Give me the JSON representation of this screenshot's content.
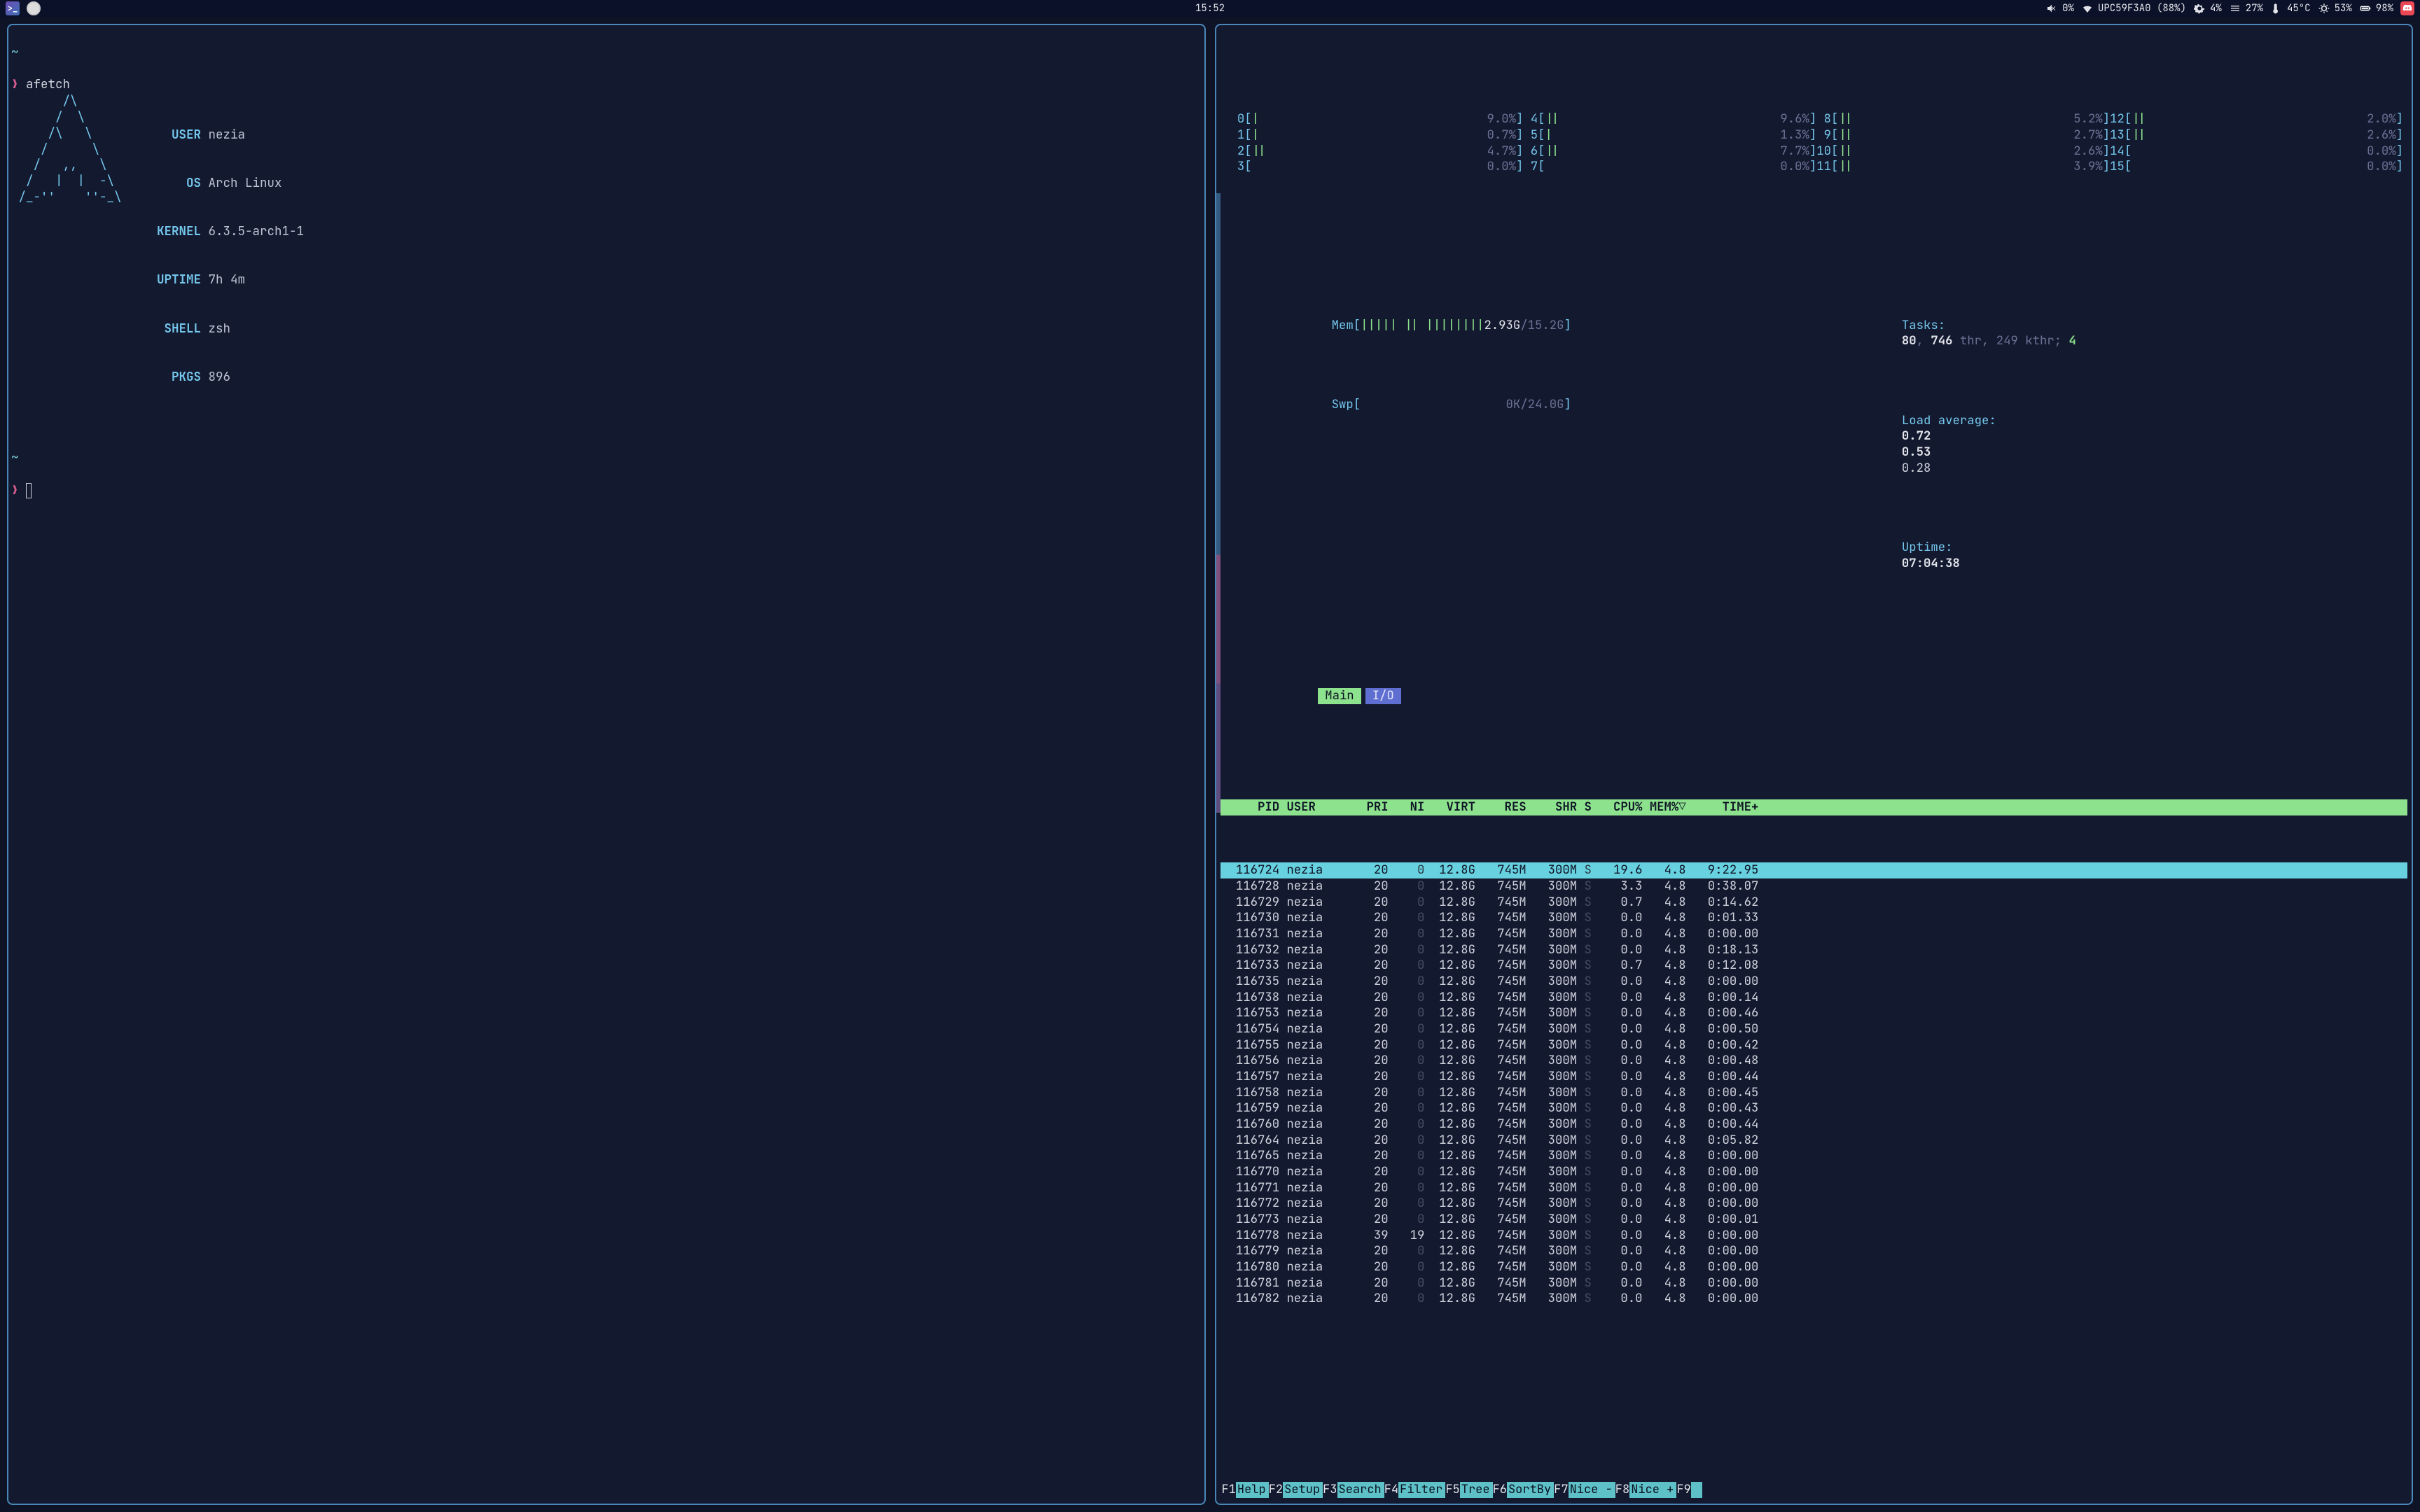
{
  "topbar": {
    "clock": "15:52",
    "vol_pct": "0%",
    "wifi": "UPC59F3A0 (88%)",
    "gear_pct": "4%",
    "menu_pct": "27%",
    "temp": "45°C",
    "bright_pct": "53%",
    "battery_pct": "98%"
  },
  "afetch": {
    "cmd": "afetch",
    "ascii": [
      "       /\\",
      "      /  \\",
      "     /\\   \\",
      "    /      \\",
      "   /   ,,   \\",
      "  /   |  |  -\\",
      " /_-''    ''-_\\"
    ],
    "labels": {
      "user": "USER",
      "os": "OS",
      "kernel": "KERNEL",
      "uptime": "UPTIME",
      "shell": "SHELL",
      "pkgs": "PKGS"
    },
    "values": {
      "user": "nezia",
      "os": "Arch Linux",
      "kernel": "6.3.5-arch1-1",
      "uptime": "7h 4m",
      "shell": "zsh",
      "pkgs": "896"
    }
  },
  "htop": {
    "cpus": [
      {
        "id": "0",
        "bar": "|",
        "pct": "9.0%"
      },
      {
        "id": "4",
        "bar": "||",
        "pct": "9.6%"
      },
      {
        "id": "8",
        "bar": "||",
        "pct": "5.2%"
      },
      {
        "id": "12",
        "bar": "||",
        "pct": "2.0%"
      },
      {
        "id": "1",
        "bar": "|",
        "pct": "0.7%"
      },
      {
        "id": "5",
        "bar": "|",
        "pct": "1.3%"
      },
      {
        "id": "9",
        "bar": "||",
        "pct": "2.7%"
      },
      {
        "id": "13",
        "bar": "||",
        "pct": "2.6%"
      },
      {
        "id": "2",
        "bar": "||",
        "pct": "4.7%"
      },
      {
        "id": "6",
        "bar": "||",
        "pct": "7.7%"
      },
      {
        "id": "10",
        "bar": "||",
        "pct": "2.6%"
      },
      {
        "id": "14",
        "bar": "",
        "pct": "0.0%"
      },
      {
        "id": "3",
        "bar": "",
        "pct": "0.0%"
      },
      {
        "id": "7",
        "bar": "",
        "pct": "0.0%"
      },
      {
        "id": "11",
        "bar": "||",
        "pct": "3.9%"
      },
      {
        "id": "15",
        "bar": "",
        "pct": "0.0%"
      }
    ],
    "mem": {
      "label": "Mem",
      "bar": "||||| || ||||||||",
      "used": "2.93G",
      "total": "15.2G"
    },
    "swp": {
      "label": "Swp",
      "used": "0K",
      "total": "24.0G"
    },
    "tasks": {
      "label": "Tasks:",
      "procs": "80",
      "thr": "746",
      "thr_lbl": " thr",
      "kthr": "249 kthr",
      "running": "4"
    },
    "load": {
      "label": "Load average:",
      "v1": "0.72",
      "v2": "0.53",
      "v3": "0.28"
    },
    "uptime": {
      "label": "Uptime:",
      "value": "07:04:38"
    },
    "tabs": {
      "main": "Main",
      "io": "I/O"
    },
    "header": {
      "pid": "PID",
      "user": "USER",
      "pri": "PRI",
      "ni": "NI",
      "virt": "VIRT",
      "res": "RES",
      "shr": "SHR",
      "s": "S",
      "cpu": "CPU%",
      "mem": "MEM%▽",
      "time": "TIME+"
    },
    "procs": [
      {
        "pid": "116724",
        "user": "nezia",
        "pri": "20",
        "ni": "0",
        "virt": "12.8G",
        "res": "745M",
        "shr": "300M",
        "s": "S",
        "cpu": "19.6",
        "mem": "4.8",
        "time": "9:22.95",
        "sel": true
      },
      {
        "pid": "116728",
        "user": "nezia",
        "pri": "20",
        "ni": "0",
        "virt": "12.8G",
        "res": "745M",
        "shr": "300M",
        "s": "S",
        "cpu": "3.3",
        "mem": "4.8",
        "time": "0:38.07"
      },
      {
        "pid": "116729",
        "user": "nezia",
        "pri": "20",
        "ni": "0",
        "virt": "12.8G",
        "res": "745M",
        "shr": "300M",
        "s": "S",
        "cpu": "0.7",
        "mem": "4.8",
        "time": "0:14.62"
      },
      {
        "pid": "116730",
        "user": "nezia",
        "pri": "20",
        "ni": "0",
        "virt": "12.8G",
        "res": "745M",
        "shr": "300M",
        "s": "S",
        "cpu": "0.0",
        "mem": "4.8",
        "time": "0:01.33"
      },
      {
        "pid": "116731",
        "user": "nezia",
        "pri": "20",
        "ni": "0",
        "virt": "12.8G",
        "res": "745M",
        "shr": "300M",
        "s": "S",
        "cpu": "0.0",
        "mem": "4.8",
        "time": "0:00.00"
      },
      {
        "pid": "116732",
        "user": "nezia",
        "pri": "20",
        "ni": "0",
        "virt": "12.8G",
        "res": "745M",
        "shr": "300M",
        "s": "S",
        "cpu": "0.0",
        "mem": "4.8",
        "time": "0:18.13"
      },
      {
        "pid": "116733",
        "user": "nezia",
        "pri": "20",
        "ni": "0",
        "virt": "12.8G",
        "res": "745M",
        "shr": "300M",
        "s": "S",
        "cpu": "0.7",
        "mem": "4.8",
        "time": "0:12.08"
      },
      {
        "pid": "116735",
        "user": "nezia",
        "pri": "20",
        "ni": "0",
        "virt": "12.8G",
        "res": "745M",
        "shr": "300M",
        "s": "S",
        "cpu": "0.0",
        "mem": "4.8",
        "time": "0:00.00"
      },
      {
        "pid": "116738",
        "user": "nezia",
        "pri": "20",
        "ni": "0",
        "virt": "12.8G",
        "res": "745M",
        "shr": "300M",
        "s": "S",
        "cpu": "0.0",
        "mem": "4.8",
        "time": "0:00.14"
      },
      {
        "pid": "116753",
        "user": "nezia",
        "pri": "20",
        "ni": "0",
        "virt": "12.8G",
        "res": "745M",
        "shr": "300M",
        "s": "S",
        "cpu": "0.0",
        "mem": "4.8",
        "time": "0:00.46"
      },
      {
        "pid": "116754",
        "user": "nezia",
        "pri": "20",
        "ni": "0",
        "virt": "12.8G",
        "res": "745M",
        "shr": "300M",
        "s": "S",
        "cpu": "0.0",
        "mem": "4.8",
        "time": "0:00.50"
      },
      {
        "pid": "116755",
        "user": "nezia",
        "pri": "20",
        "ni": "0",
        "virt": "12.8G",
        "res": "745M",
        "shr": "300M",
        "s": "S",
        "cpu": "0.0",
        "mem": "4.8",
        "time": "0:00.42"
      },
      {
        "pid": "116756",
        "user": "nezia",
        "pri": "20",
        "ni": "0",
        "virt": "12.8G",
        "res": "745M",
        "shr": "300M",
        "s": "S",
        "cpu": "0.0",
        "mem": "4.8",
        "time": "0:00.48"
      },
      {
        "pid": "116757",
        "user": "nezia",
        "pri": "20",
        "ni": "0",
        "virt": "12.8G",
        "res": "745M",
        "shr": "300M",
        "s": "S",
        "cpu": "0.0",
        "mem": "4.8",
        "time": "0:00.44"
      },
      {
        "pid": "116758",
        "user": "nezia",
        "pri": "20",
        "ni": "0",
        "virt": "12.8G",
        "res": "745M",
        "shr": "300M",
        "s": "S",
        "cpu": "0.0",
        "mem": "4.8",
        "time": "0:00.45"
      },
      {
        "pid": "116759",
        "user": "nezia",
        "pri": "20",
        "ni": "0",
        "virt": "12.8G",
        "res": "745M",
        "shr": "300M",
        "s": "S",
        "cpu": "0.0",
        "mem": "4.8",
        "time": "0:00.43"
      },
      {
        "pid": "116760",
        "user": "nezia",
        "pri": "20",
        "ni": "0",
        "virt": "12.8G",
        "res": "745M",
        "shr": "300M",
        "s": "S",
        "cpu": "0.0",
        "mem": "4.8",
        "time": "0:00.44"
      },
      {
        "pid": "116764",
        "user": "nezia",
        "pri": "20",
        "ni": "0",
        "virt": "12.8G",
        "res": "745M",
        "shr": "300M",
        "s": "S",
        "cpu": "0.0",
        "mem": "4.8",
        "time": "0:05.82"
      },
      {
        "pid": "116765",
        "user": "nezia",
        "pri": "20",
        "ni": "0",
        "virt": "12.8G",
        "res": "745M",
        "shr": "300M",
        "s": "S",
        "cpu": "0.0",
        "mem": "4.8",
        "time": "0:00.00"
      },
      {
        "pid": "116770",
        "user": "nezia",
        "pri": "20",
        "ni": "0",
        "virt": "12.8G",
        "res": "745M",
        "shr": "300M",
        "s": "S",
        "cpu": "0.0",
        "mem": "4.8",
        "time": "0:00.00"
      },
      {
        "pid": "116771",
        "user": "nezia",
        "pri": "20",
        "ni": "0",
        "virt": "12.8G",
        "res": "745M",
        "shr": "300M",
        "s": "S",
        "cpu": "0.0",
        "mem": "4.8",
        "time": "0:00.00"
      },
      {
        "pid": "116772",
        "user": "nezia",
        "pri": "20",
        "ni": "0",
        "virt": "12.8G",
        "res": "745M",
        "shr": "300M",
        "s": "S",
        "cpu": "0.0",
        "mem": "4.8",
        "time": "0:00.00"
      },
      {
        "pid": "116773",
        "user": "nezia",
        "pri": "20",
        "ni": "0",
        "virt": "12.8G",
        "res": "745M",
        "shr": "300M",
        "s": "S",
        "cpu": "0.0",
        "mem": "4.8",
        "time": "0:00.01"
      },
      {
        "pid": "116778",
        "user": "nezia",
        "pri": "39",
        "ni": "19",
        "virt": "12.8G",
        "res": "745M",
        "shr": "300M",
        "s": "S",
        "cpu": "0.0",
        "mem": "4.8",
        "time": "0:00.00"
      },
      {
        "pid": "116779",
        "user": "nezia",
        "pri": "20",
        "ni": "0",
        "virt": "12.8G",
        "res": "745M",
        "shr": "300M",
        "s": "S",
        "cpu": "0.0",
        "mem": "4.8",
        "time": "0:00.00"
      },
      {
        "pid": "116780",
        "user": "nezia",
        "pri": "20",
        "ni": "0",
        "virt": "12.8G",
        "res": "745M",
        "shr": "300M",
        "s": "S",
        "cpu": "0.0",
        "mem": "4.8",
        "time": "0:00.00"
      },
      {
        "pid": "116781",
        "user": "nezia",
        "pri": "20",
        "ni": "0",
        "virt": "12.8G",
        "res": "745M",
        "shr": "300M",
        "s": "S",
        "cpu": "0.0",
        "mem": "4.8",
        "time": "0:00.00"
      },
      {
        "pid": "116782",
        "user": "nezia",
        "pri": "20",
        "ni": "0",
        "virt": "12.8G",
        "res": "745M",
        "shr": "300M",
        "s": "S",
        "cpu": "0.0",
        "mem": "4.8",
        "time": "0:00.00"
      }
    ],
    "footer": [
      {
        "k": "F1",
        "a": "Help"
      },
      {
        "k": "F2",
        "a": "Setup"
      },
      {
        "k": "F3",
        "a": "Search"
      },
      {
        "k": "F4",
        "a": "Filter"
      },
      {
        "k": "F5",
        "a": "Tree"
      },
      {
        "k": "F6",
        "a": "SortBy"
      },
      {
        "k": "F7",
        "a": "Nice -"
      },
      {
        "k": "F8",
        "a": "Nice +"
      },
      {
        "k": "F9",
        "a": ""
      }
    ]
  }
}
